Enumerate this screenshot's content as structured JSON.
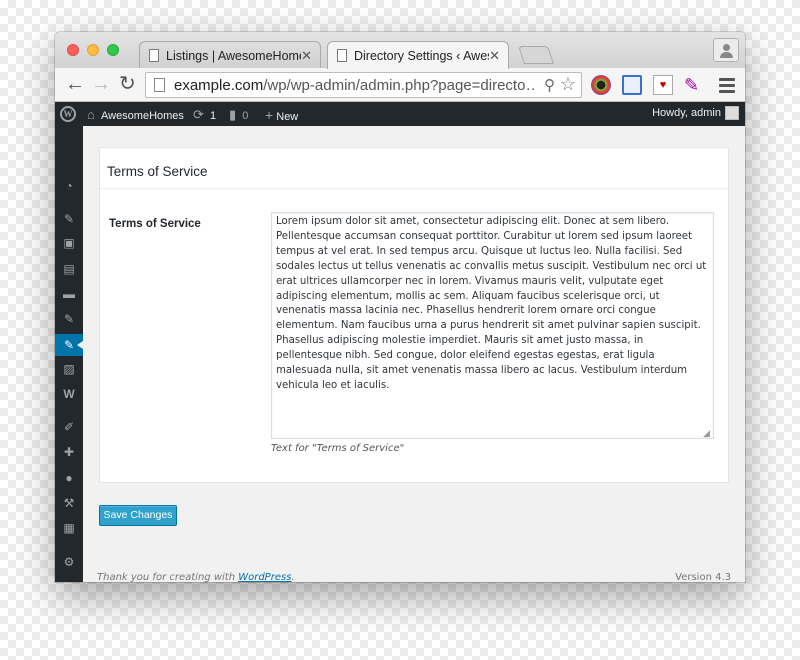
{
  "browser": {
    "tabs": [
      {
        "label": "Listings | AwesomeHomes",
        "close": "✕"
      },
      {
        "label": "Directory Settings ‹ AwesomeHomes",
        "close": "✕"
      }
    ],
    "url_host": "example.com",
    "url_path": "/wp/wp-admin/admin.php?page=directo…",
    "nav": {
      "back": "←",
      "forward": "→",
      "reload": "↻"
    },
    "extensions": [
      "color-picker-icon",
      "screenshot-icon",
      "pocket-icon",
      "feather-icon"
    ]
  },
  "adminbar": {
    "site_name": "AwesomeHomes",
    "updates_count": "1",
    "comments_count": "0",
    "new_label": "New",
    "howdy": "Howdy, admin"
  },
  "sidebar": {
    "icons": [
      "dashboard-icon",
      "pin-icon",
      "media-icon",
      "pages-icon",
      "comments-icon",
      "pin-icon",
      "directory-icon",
      "gallery-icon",
      "woocommerce-icon",
      "appearance-icon",
      "plugins-icon",
      "users-icon",
      "tools-icon",
      "settings-icon",
      "collapse-icon"
    ],
    "active_index": 6
  },
  "panel": {
    "title": "Terms of Service",
    "field_label": "Terms of Service",
    "tos_text": "Lorem ipsum dolor sit amet, consectetur adipiscing elit. Donec at sem libero. Pellentesque accumsan consequat porttitor. Curabitur ut lorem sed ipsum laoreet tempus at vel erat. In sed tempus arcu. Quisque ut luctus leo. Nulla facilisi. Sed sodales lectus ut tellus venenatis ac convallis metus suscipit. Vestibulum nec orci ut erat ultrices ullamcorper nec in lorem. Vivamus mauris velit, vulputate eget adipiscing elementum, mollis ac sem. Aliquam faucibus scelerisque orci, ut venenatis massa lacinia nec. Phasellus hendrerit lorem ornare orci congue elementum. Nam faucibus urna a purus hendrerit sit amet pulvinar sapien suscipit. Phasellus adipiscing molestie imperdiet. Mauris sit amet justo massa, in pellentesque nibh. Sed congue, dolor eleifend egestas egestas, erat ligula malesuada nulla, sit amet venenatis massa libero ac lacus. Vestibulum interdum vehicula leo et iaculis.",
    "field_description": "Text for \"Terms of Service\""
  },
  "save_button": "Save Changes",
  "footer": {
    "thanks_prefix": "Thank you for creating with ",
    "thanks_link": "WordPress",
    "thanks_suffix": ".",
    "version": "Version 4.3"
  },
  "colors": {
    "admin_bar_bg": "#23282d",
    "accent": "#0073aa",
    "button": "#2ea2cc"
  }
}
